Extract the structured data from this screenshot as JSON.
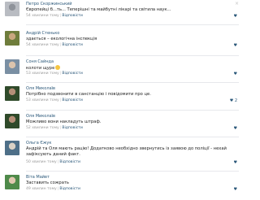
{
  "comments": [
    {
      "author": "Петро Скоржинський",
      "text": "Європейці б...ть... Теперішні та майбутні лікарі та світила наук...",
      "time": "54 хвилини тому",
      "reply": "Відповісти",
      "likes": "",
      "avatar_colors": [
        "#b9bcc2",
        "#8f939a"
      ]
    },
    {
      "author": "Андрій Стенько",
      "text": "здається – екологічна інспекція",
      "time": "54 хвилини тому",
      "reply": "Відповісти",
      "likes": "",
      "avatar_colors": [
        "#6f7d3c",
        "#c9a77f"
      ]
    },
    {
      "author": "Соня Сайнда",
      "text": "колоти щуре",
      "time": "53 хвилини тому",
      "reply": "Відповісти",
      "likes": "",
      "emoji_icon": "winking-face-icon",
      "avatar_colors": [
        "#7a8fa3",
        "#dcc4ad"
      ]
    },
    {
      "author": "Оля Миколаїв",
      "text": "Потрібно подзвонити в санстанцію і повідомити про це.",
      "time": "53 хвилини тому",
      "reply": "Відповісти",
      "likes": "2",
      "avatar_colors": [
        "#2f4a2a",
        "#b48f78"
      ]
    },
    {
      "author": "Оля Миколаїв",
      "text": "Можливо вони накладуть штраф.",
      "time": "52 хвилини тому",
      "reply": "Відповісти",
      "likes": "",
      "avatar_colors": [
        "#2f4a2a",
        "#b48f78"
      ]
    },
    {
      "author": "Ольга Єжук",
      "text": "Андрій та Оля мають рацію! Додатково необхідно звернутись із заявою до поліції - нехай зафіксують даний факт.",
      "time": "50 хвилин тому",
      "reply": "Відповісти",
      "likes": "",
      "avatar_colors": [
        "#4e6f88",
        "#d9d1c5"
      ]
    },
    {
      "author": "Віта Майвт",
      "text": "Заставить сожрать",
      "time": "49 хвилин тому",
      "reply": "Відповісти",
      "likes": "",
      "avatar_colors": [
        "#4f8a4a",
        "#e0c8b0"
      ]
    }
  ],
  "icons": {
    "close": "close-icon",
    "like": "heart-icon"
  },
  "colors": {
    "link": "#2b587a",
    "meta": "#999999",
    "text": "#222222",
    "divider": "#e7e8ec"
  }
}
